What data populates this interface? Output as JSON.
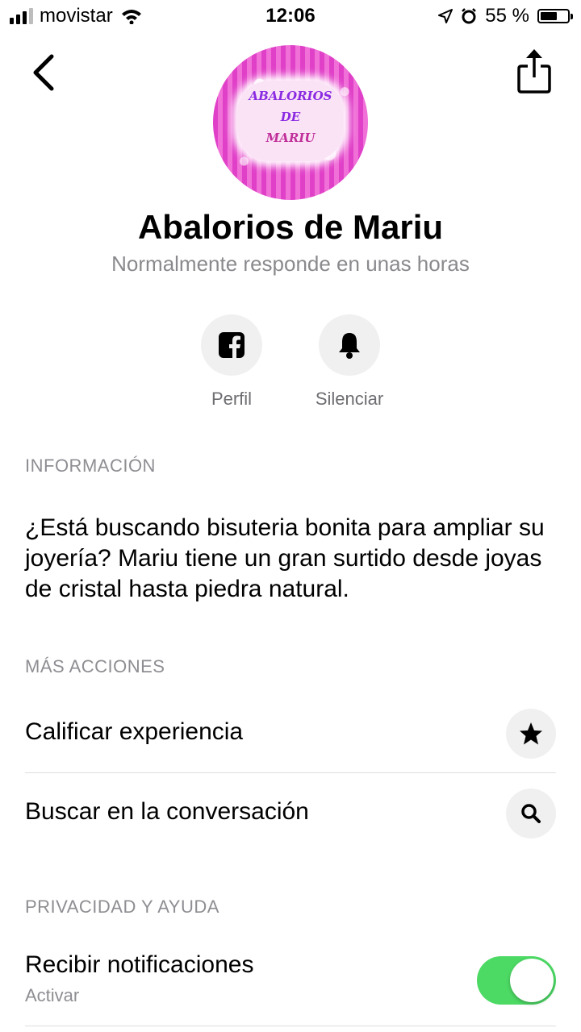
{
  "status_bar": {
    "carrier": "movistar",
    "time": "12:06",
    "battery": "55 %"
  },
  "profile": {
    "avatar_text": [
      "ABALORIOS",
      "DE",
      "MARIU"
    ],
    "name": "Abalorios de Mariu",
    "response_time": "Normalmente responde en unas horas"
  },
  "actions": [
    {
      "label": "Perfil",
      "icon": "facebook-icon"
    },
    {
      "label": "Silenciar",
      "icon": "bell-icon"
    }
  ],
  "info": {
    "header": "INFORMACIÓN",
    "text": "¿Está buscando bisuteria bonita para ampliar su joyería? Mariu tiene un gran surtido desde joyas de cristal hasta piedra natural."
  },
  "more_actions": {
    "header": "MÁS ACCIONES",
    "items": [
      {
        "label": "Calificar experiencia",
        "icon": "star-icon"
      },
      {
        "label": "Buscar en la conversación",
        "icon": "search-icon"
      }
    ]
  },
  "privacy": {
    "header": "PRIVACIDAD Y AYUDA",
    "notifications_label": "Recibir notificaciones",
    "notifications_sub": "Activar",
    "notifications_on": true
  },
  "colors": {
    "toggle_on": "#4cd964",
    "secondary_text": "#8e8e93",
    "icon_bg": "#f0f0f0"
  }
}
